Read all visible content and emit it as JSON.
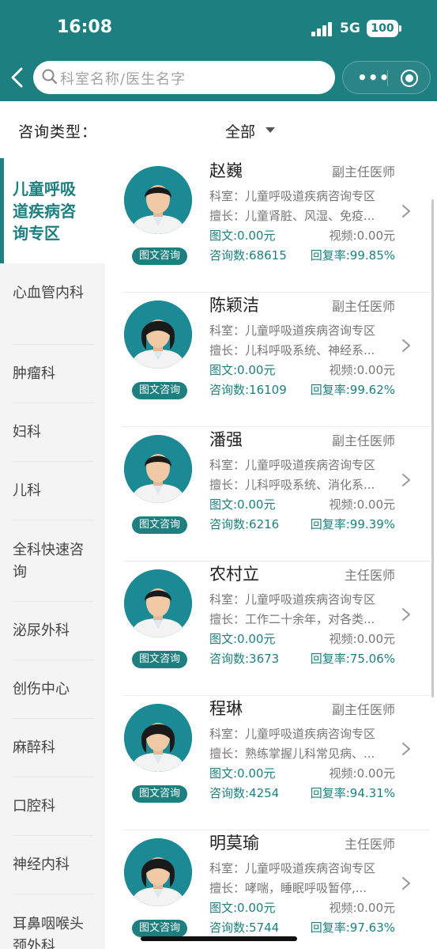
{
  "status_bar": {
    "time": "16:08",
    "network": "5G",
    "battery": "100"
  },
  "header": {
    "search_placeholder": "科室名称/医生名字"
  },
  "filter": {
    "label": "咨询类型：",
    "value": "全部"
  },
  "sidebar": {
    "items": [
      {
        "label": "儿童呼吸道疾病咨询专区",
        "active": true
      },
      {
        "label": "心血管内科",
        "active": false
      },
      {
        "label": "肿瘤科",
        "active": false
      },
      {
        "label": "妇科",
        "active": false
      },
      {
        "label": "儿科",
        "active": false
      },
      {
        "label": "全科快速咨询",
        "active": false
      },
      {
        "label": "泌尿外科",
        "active": false
      },
      {
        "label": "创伤中心",
        "active": false
      },
      {
        "label": "麻醉科",
        "active": false
      },
      {
        "label": "口腔科",
        "active": false
      },
      {
        "label": "神经内科",
        "active": false
      },
      {
        "label": "耳鼻咽喉头颈外科",
        "active": false
      }
    ]
  },
  "doctors": [
    {
      "name": "赵巍",
      "title": "副主任医师",
      "dept": "科室：儿童呼吸道疾病咨询专区",
      "skill": "擅长：儿童肾脏、风湿、免疫...",
      "price_text": "图文:0.00元",
      "price_video": "视频:0.00元",
      "count": "咨询数:68615",
      "rate": "回复率:99.85%",
      "tag": "图文咨询",
      "gender": "m"
    },
    {
      "name": "陈颖洁",
      "title": "副主任医师",
      "dept": "科室：儿童呼吸道疾病咨询专区",
      "skill": "擅长：儿科呼吸系统、神经系...",
      "price_text": "图文:0.00元",
      "price_video": "视频:0.00元",
      "count": "咨询数:16109",
      "rate": "回复率:99.62%",
      "tag": "图文咨询",
      "gender": "f"
    },
    {
      "name": "潘强",
      "title": "副主任医师",
      "dept": "科室：儿童呼吸道疾病咨询专区",
      "skill": "擅长：儿科呼吸系统、消化系...",
      "price_text": "图文:0.00元",
      "price_video": "视频:0.00元",
      "count": "咨询数:6216",
      "rate": "回复率:99.39%",
      "tag": "图文咨询",
      "gender": "m"
    },
    {
      "name": "农村立",
      "title": "主任医师",
      "dept": "科室：儿童呼吸道疾病咨询专区",
      "skill": "擅长：工作二十余年，对各类...",
      "price_text": "图文:0.00元",
      "price_video": "视频:0.00元",
      "count": "咨询数:3673",
      "rate": "回复率:75.06%",
      "tag": "图文咨询",
      "gender": "m"
    },
    {
      "name": "程琳",
      "title": "副主任医师",
      "dept": "科室：儿童呼吸道疾病咨询专区",
      "skill": "擅长：熟练掌握儿科常见病、...",
      "price_text": "图文:0.00元",
      "price_video": "视频:0.00元",
      "count": "咨询数:4254",
      "rate": "回复率:94.31%",
      "tag": "图文咨询",
      "gender": "f"
    },
    {
      "name": "明莫瑜",
      "title": "主任医师",
      "dept": "科室：儿童呼吸道疾病咨询专区",
      "skill": "擅长：哮喘，睡眠呼吸暂停,...",
      "price_text": "图文:0.00元",
      "price_video": "视频:0.00元",
      "count": "咨询数:5744",
      "rate": "回复率:97.63%",
      "tag": "图文咨询",
      "gender": "f"
    }
  ]
}
